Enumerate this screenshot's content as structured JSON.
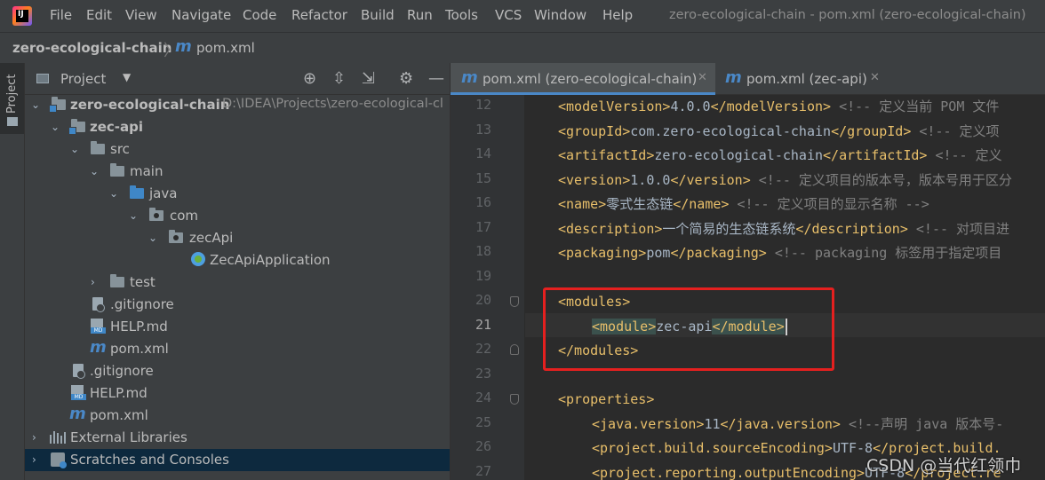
{
  "menubar": {
    "items": [
      "File",
      "Edit",
      "View",
      "Navigate",
      "Code",
      "Refactor",
      "Build",
      "Run",
      "Tools",
      "VCS",
      "Window",
      "Help"
    ],
    "window_title": "zero-ecological-chain - pom.xml (zero-ecological-chain)"
  },
  "navbar": {
    "project": "zero-ecological-chain",
    "file": "pom.xml"
  },
  "sidebar": {
    "tab_label": "Project"
  },
  "project_panel": {
    "title": "Project",
    "tree": [
      {
        "label": "zero-ecological-chain",
        "path": "D:\\IDEA\\Projects\\zero-ecological-cl"
      },
      {
        "label": "zec-api"
      },
      {
        "label": "src"
      },
      {
        "label": "main"
      },
      {
        "label": "java"
      },
      {
        "label": "com"
      },
      {
        "label": "zecApi"
      },
      {
        "label": "ZecApiApplication"
      },
      {
        "label": "test"
      },
      {
        "label": ".gitignore"
      },
      {
        "label": "HELP.md"
      },
      {
        "label": "pom.xml"
      },
      {
        "label": ".gitignore"
      },
      {
        "label": "HELP.md"
      },
      {
        "label": "pom.xml"
      },
      {
        "label": "External Libraries"
      },
      {
        "label": "Scratches and Consoles"
      }
    ]
  },
  "tabs": [
    {
      "label": "pom.xml (zero-ecological-chain)",
      "active": true
    },
    {
      "label": "pom.xml (zec-api)",
      "active": false
    }
  ],
  "editor": {
    "current_line": 21,
    "lines": [
      {
        "n": "12",
        "indent": 1,
        "segs": [
          [
            "t",
            "<modelVersion>"
          ],
          [
            "v",
            "4.0.0"
          ],
          [
            "t",
            "</modelVersion>"
          ],
          [
            "c",
            " <!-- 定义当前 POM 文件"
          ]
        ]
      },
      {
        "n": "13",
        "indent": 1,
        "segs": [
          [
            "t",
            "<groupId>"
          ],
          [
            "v",
            "com.zero-ecological-chain"
          ],
          [
            "t",
            "</groupId>"
          ],
          [
            "c",
            " <!-- 定义项"
          ]
        ]
      },
      {
        "n": "14",
        "indent": 1,
        "segs": [
          [
            "t",
            "<artifactId>"
          ],
          [
            "v",
            "zero-ecological-chain"
          ],
          [
            "t",
            "</artifactId>"
          ],
          [
            "c",
            " <!-- 定义"
          ]
        ]
      },
      {
        "n": "15",
        "indent": 1,
        "segs": [
          [
            "t",
            "<version>"
          ],
          [
            "v",
            "1.0.0"
          ],
          [
            "t",
            "</version>"
          ],
          [
            "c",
            " <!-- 定义项目的版本号，版本号用于区分"
          ]
        ]
      },
      {
        "n": "16",
        "indent": 1,
        "segs": [
          [
            "t",
            "<name>"
          ],
          [
            "v",
            "零式生态链"
          ],
          [
            "t",
            "</name>"
          ],
          [
            "c",
            " <!-- 定义项目的显示名称 -->"
          ]
        ]
      },
      {
        "n": "17",
        "indent": 1,
        "segs": [
          [
            "t",
            "<description>"
          ],
          [
            "v",
            "一个简易的生态链系统"
          ],
          [
            "t",
            "</description>"
          ],
          [
            "c",
            " <!-- 对项目进"
          ]
        ]
      },
      {
        "n": "18",
        "indent": 1,
        "segs": [
          [
            "t",
            "<packaging>"
          ],
          [
            "v",
            "pom"
          ],
          [
            "t",
            "</packaging>"
          ],
          [
            "c",
            " <!-- packaging 标签用于指定项目"
          ]
        ]
      },
      {
        "n": "19",
        "indent": 0,
        "segs": []
      },
      {
        "n": "20",
        "indent": 1,
        "segs": [
          [
            "t",
            "<modules>"
          ]
        ]
      },
      {
        "n": "21",
        "indent": 2,
        "segs": [
          [
            "th",
            "<module>"
          ],
          [
            "v",
            "zec-api"
          ],
          [
            "th",
            "</module>"
          ]
        ]
      },
      {
        "n": "22",
        "indent": 1,
        "segs": [
          [
            "t",
            "</modules>"
          ]
        ]
      },
      {
        "n": "23",
        "indent": 0,
        "segs": []
      },
      {
        "n": "24",
        "indent": 1,
        "segs": [
          [
            "t",
            "<properties>"
          ]
        ]
      },
      {
        "n": "25",
        "indent": 2,
        "segs": [
          [
            "t",
            "<java.version>"
          ],
          [
            "v",
            "11"
          ],
          [
            "t",
            "</java.version>"
          ],
          [
            "c",
            " <!--声明 java 版本号-"
          ]
        ]
      },
      {
        "n": "26",
        "indent": 2,
        "segs": [
          [
            "t",
            "<project.build.sourceEncoding>"
          ],
          [
            "v",
            "UTF-8"
          ],
          [
            "t",
            "</project.build."
          ]
        ]
      },
      {
        "n": "27",
        "indent": 2,
        "segs": [
          [
            "t",
            "<project.reporting.outputEncoding>"
          ],
          [
            "v",
            "UTF-8"
          ],
          [
            "t",
            "</project.re"
          ]
        ]
      }
    ]
  },
  "watermark": "CSDN @当代红领巾",
  "colors": {
    "tag": "#e8bf6a",
    "text": "#a9b7c6",
    "comment": "#808080",
    "highlight_box": "#e5201f",
    "accent": "#4a88c7"
  }
}
